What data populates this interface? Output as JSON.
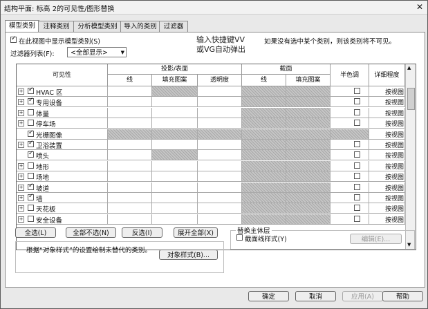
{
  "window": {
    "title": "结构平面: 标高 2的可见性/图形替换"
  },
  "tabs": [
    "模型类别",
    "注释类别",
    "分析模型类别",
    "导入的类别",
    "过滤器"
  ],
  "show_model": {
    "label": "在此视图中显示模型类别(S)",
    "checked": true
  },
  "filter": {
    "label": "过滤器列表(F):",
    "value": "<全部显示>"
  },
  "annotation": {
    "line1": "输入快捷键VV",
    "line2": "或VG自动弹出"
  },
  "hint": "如果没有选中某个类别，则该类别将不可见。",
  "headers": {
    "visibility": "可见性",
    "projection": "投影/表面",
    "section": "截面",
    "halftone": "半色调",
    "detail": "详细程度",
    "line": "线",
    "fill": "填充图案",
    "transparency": "透明度"
  },
  "rows": [
    {
      "name": "HVAC 区",
      "expand": "+",
      "checked": true,
      "detail": "按视图"
    },
    {
      "name": "专用设备",
      "expand": "+",
      "checked": true,
      "detail": "按视图"
    },
    {
      "name": "体量",
      "expand": "+",
      "checked": false,
      "detail": "按视图"
    },
    {
      "name": "停车场",
      "expand": "+",
      "checked": false,
      "detail": "按视图"
    },
    {
      "name": "光栅图像",
      "expand": "",
      "checked": true,
      "detail": "按视图"
    },
    {
      "name": "卫浴装置",
      "expand": "+",
      "checked": true,
      "detail": "按视图"
    },
    {
      "name": "喷头",
      "expand": "",
      "checked": true,
      "detail": "按视图"
    },
    {
      "name": "地形",
      "expand": "+",
      "checked": false,
      "detail": "按视图"
    },
    {
      "name": "场地",
      "expand": "+",
      "checked": false,
      "detail": "按视图"
    },
    {
      "name": "坡道",
      "expand": "+",
      "checked": true,
      "detail": "按视图"
    },
    {
      "name": "墙",
      "expand": "+",
      "checked": true,
      "detail": "按视图"
    },
    {
      "name": "天花板",
      "expand": "+",
      "checked": false,
      "detail": "按视图"
    },
    {
      "name": "安全设备",
      "expand": "+",
      "checked": false,
      "detail": "按视图"
    }
  ],
  "buttons": {
    "select_all": "全选(L)",
    "select_none": "全部不选(N)",
    "invert": "反选(I)",
    "expand_all": "展开全部(X)",
    "object_styles": "对象样式(B)...",
    "edit": "编辑(E)...",
    "ok": "确定",
    "cancel": "取消",
    "apply": "应用(A)",
    "help": "帮助"
  },
  "override_host": {
    "title": "替换主体层",
    "cut_line": "截面线样式(Y)",
    "checked": false
  },
  "object_note": "根据“对象样式”的设置绘制未替代的类别。"
}
